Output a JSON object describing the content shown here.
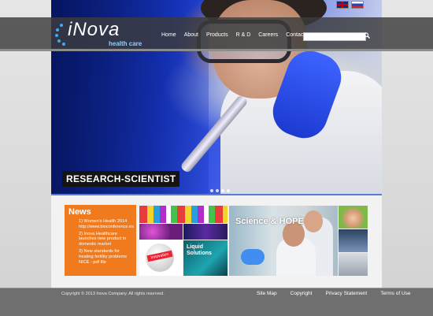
{
  "header": {
    "logo_text": "iNova",
    "logo_sub": "health care",
    "flags": [
      {
        "name": "uk-flag-icon"
      },
      {
        "name": "ru-flag-icon"
      }
    ],
    "nav": [
      "Home",
      "About",
      "Products",
      "R & D",
      "Careers",
      "Contact"
    ],
    "search_placeholder": ""
  },
  "hero": {
    "caption": "RESEARCH-SCIENTIST",
    "slide_count": 4
  },
  "news": {
    "title": "News",
    "items": [
      "1) Women's Health 2014 http://www.bioconference.es",
      "2) Inova Healthcare launches new product in domestic market",
      "3) New standards for treating fertility problems NICE - pdf file"
    ]
  },
  "collage": {
    "ball_text": "Innovation",
    "liquid_text": "Liquid Solutions",
    "science_text": "Science & HOPE"
  },
  "footer": {
    "copyright": "Copyright © 2013 Inova Company. All rights reserved.",
    "links": [
      "Site Map",
      "Copyright",
      "Privacy Statement",
      "Terms of Use"
    ]
  }
}
